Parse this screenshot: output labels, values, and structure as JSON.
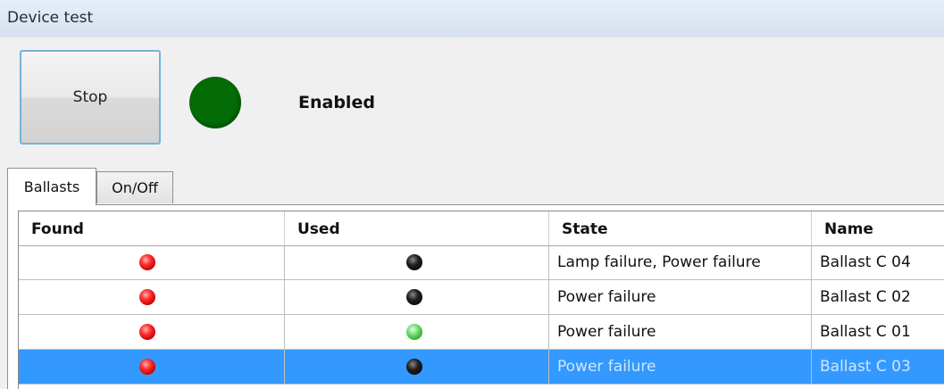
{
  "window": {
    "title": "Device test"
  },
  "controls": {
    "stop_label": "Stop",
    "status_text": "Enabled",
    "status_color": "#036c06"
  },
  "tabs": [
    {
      "label": "Ballasts",
      "active": true
    },
    {
      "label": "On/Off",
      "active": false
    }
  ],
  "table": {
    "columns": [
      "Found",
      "Used",
      "State",
      "Name"
    ],
    "rows": [
      {
        "found": "red",
        "used": "black",
        "state": "Lamp failure, Power failure",
        "name": "Ballast C 04",
        "selected": false
      },
      {
        "found": "red",
        "used": "black",
        "state": "Power failure",
        "name": "Ballast C 02",
        "selected": false
      },
      {
        "found": "red",
        "used": "green",
        "state": "Power failure",
        "name": "Ballast C 01",
        "selected": false
      },
      {
        "found": "red",
        "used": "black",
        "state": "Power failure",
        "name": "Ballast C 03",
        "selected": true
      }
    ],
    "selection_color": "#3399ff"
  }
}
